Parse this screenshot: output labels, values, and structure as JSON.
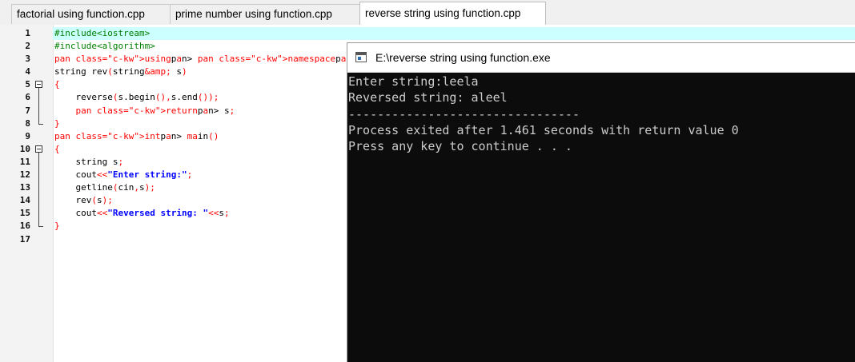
{
  "tabs": [
    {
      "label": "factorial using function.cpp",
      "active": false
    },
    {
      "label": "prime number using function.cpp",
      "active": false
    },
    {
      "label": "reverse string using function.cpp",
      "active": true
    }
  ],
  "editor": {
    "current_line": 1,
    "line_numbers": [
      "1",
      "2",
      "3",
      "4",
      "5",
      "6",
      "7",
      "8",
      "9",
      "10",
      "11",
      "12",
      "13",
      "14",
      "15",
      "16",
      "17"
    ],
    "code": [
      "#include<iostream>",
      "#include<algorithm>",
      "using namespace std;",
      "string rev(string& s)",
      "{",
      "    reverse(s.begin(),s.end());",
      "    return s;",
      "}",
      "int main()",
      "{",
      "    string s;",
      "    cout<<\"Enter string:\";",
      "    getline(cin,s);",
      "    rev(s);",
      "    cout<<\"Reversed string: \"<<s;",
      "}",
      ""
    ]
  },
  "console": {
    "title": "E:\\reverse string using function.exe",
    "lines": [
      "Enter string:leela",
      "Reversed string: aleel",
      "--------------------------------",
      "Process exited after 1.461 seconds with return value 0",
      "Press any key to continue . . ."
    ]
  },
  "colors": {
    "preprocessor": "#008000",
    "string": "#0000ff",
    "brace": "#ff0000",
    "current_line_bg": "#ccffff",
    "console_bg": "#0c0c0c",
    "console_text": "#cccccc"
  },
  "icons": {
    "fold": "fold-minus-icon",
    "console": "console-window-icon"
  }
}
